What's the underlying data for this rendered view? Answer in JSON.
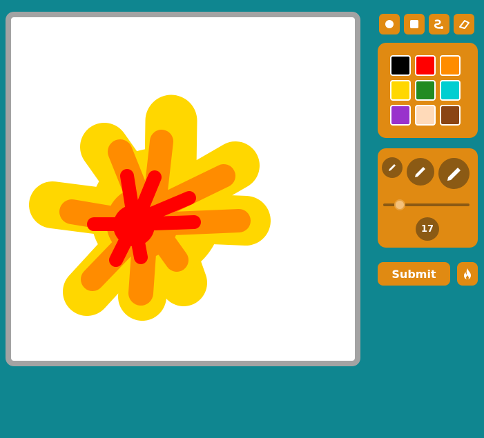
{
  "toolbar": {
    "tools": [
      {
        "name": "circle-brush",
        "icon": "circle-icon"
      },
      {
        "name": "square-brush",
        "icon": "square-icon"
      },
      {
        "name": "curve-tool",
        "icon": "curve-icon"
      },
      {
        "name": "eraser",
        "icon": "eraser-icon"
      }
    ]
  },
  "palette": {
    "colors": [
      "#000000",
      "#ff0000",
      "#ff8c00",
      "#ffd700",
      "#228b22",
      "#00ced1",
      "#9932cc",
      "#ffdab9",
      "#8b4513"
    ]
  },
  "brush": {
    "size": 17,
    "size_label": "17",
    "size_min": 1,
    "size_max": 100
  },
  "actions": {
    "submit_label": "Submit",
    "fire_icon": "fire-icon"
  },
  "colors": {
    "background": "#0f8690",
    "panel": "#e08a12",
    "canvas": "#ffffff",
    "frame": "#a3a3a3"
  }
}
